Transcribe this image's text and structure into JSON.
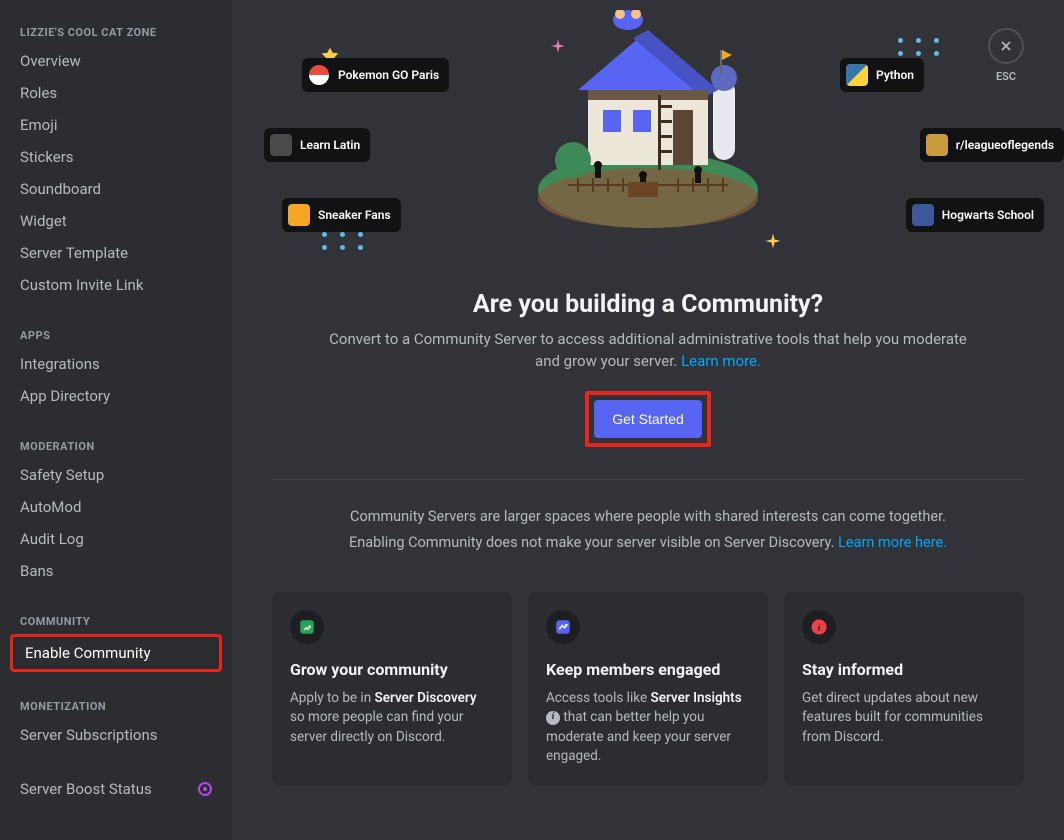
{
  "sidebar": {
    "server_name": "LIZZIE'S COOL CAT ZONE",
    "sections": {
      "main": [
        "Overview",
        "Roles",
        "Emoji",
        "Stickers",
        "Soundboard",
        "Widget",
        "Server Template",
        "Custom Invite Link"
      ],
      "apps_header": "APPS",
      "apps": [
        "Integrations",
        "App Directory"
      ],
      "moderation_header": "MODERATION",
      "moderation": [
        "Safety Setup",
        "AutoMod",
        "Audit Log",
        "Bans"
      ],
      "community_header": "COMMUNITY",
      "community": [
        "Enable Community"
      ],
      "monetization_header": "MONETIZATION",
      "monetization": [
        "Server Subscriptions"
      ],
      "boost": "Server Boost Status"
    }
  },
  "close_label": "ESC",
  "hero_chips": {
    "pokemon": "Pokemon GO Paris",
    "latin": "Learn Latin",
    "sneaker": "Sneaker Fans",
    "python": "Python",
    "league": "r/leagueoflegends",
    "hogwarts": "Hogwarts School"
  },
  "content": {
    "title": "Are you building a Community?",
    "subtitle_before": "Convert to a Community Server to access additional administrative tools that help you moderate and grow your server. ",
    "learn_more": "Learn more.",
    "cta": "Get Started",
    "info_line1": "Community Servers are larger spaces where people with shared interests can come together.",
    "info_line2_before": "Enabling Community does not make your server visible on Server Discovery. ",
    "info_line2_link": "Learn more here."
  },
  "cards": {
    "grow": {
      "title": "Grow your community",
      "body_before": "Apply to be in ",
      "body_bold": "Server Discovery",
      "body_after": " so more people can find your server directly on Discord."
    },
    "engage": {
      "title": "Keep members engaged",
      "body_before": "Access tools like ",
      "body_bold": "Server Insights",
      "body_after": " that can better help you moderate and keep your server engaged."
    },
    "informed": {
      "title": "Stay informed",
      "body": "Get direct updates about new features built for communities from Discord."
    }
  },
  "colors": {
    "accent": "#5865f2",
    "highlight": "#e8261f",
    "link": "#00a8fc"
  }
}
